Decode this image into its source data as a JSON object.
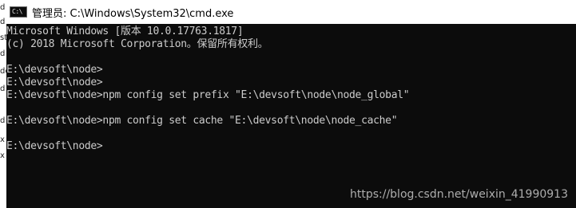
{
  "left_strip": [
    "d",
    "d",
    "sta",
    "d",
    "de",
    "d",
    "d",
    "x",
    "x"
  ],
  "window": {
    "title": "管理员: C:\\Windows\\System32\\cmd.exe",
    "icon": "cmd-icon",
    "icon_glyph": "C:\\"
  },
  "console": {
    "lines": [
      "Microsoft Windows [版本 10.0.17763.1817]",
      "(c) 2018 Microsoft Corporation。保留所有权利。",
      "",
      "E:\\devsoft\\node>",
      "E:\\devsoft\\node>",
      "E:\\devsoft\\node>npm config set prefix \"E:\\devsoft\\node\\node_global\"",
      "",
      "E:\\devsoft\\node>npm config set cache \"E:\\devsoft\\node\\node_cache\"",
      "",
      "E:\\devsoft\\node>"
    ]
  },
  "watermark": "https://blog.csdn.net/weixin_41990913",
  "colors": {
    "console_bg": "#0c0c0c",
    "console_text": "#cccccc",
    "titlebar_bg": "#ffffff"
  }
}
